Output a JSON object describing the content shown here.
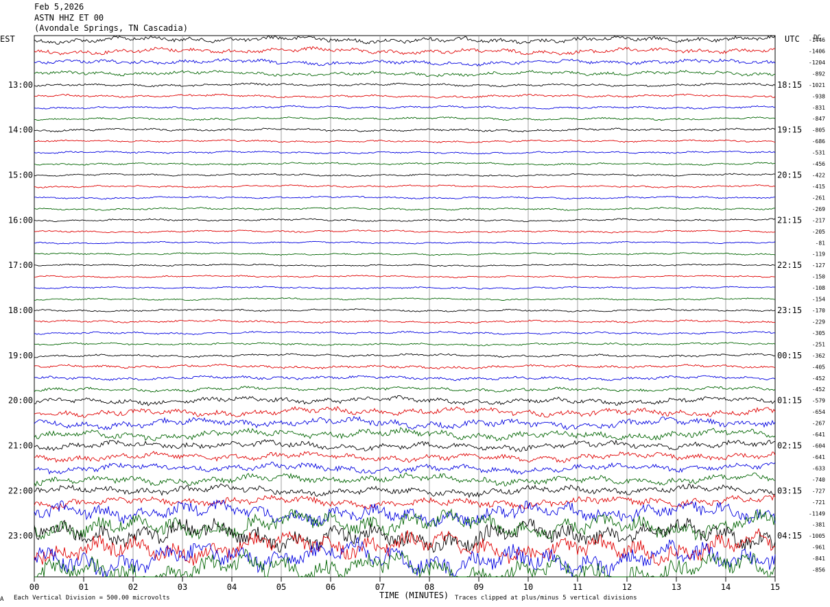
{
  "header": {
    "date": "Feb 5,2026",
    "station": "ASTN HHZ ET 00",
    "location": "(Avondale Springs, TN Cascadia)"
  },
  "left_axis_label": "EST",
  "right_axis_label": "UTC",
  "dc_label": "DC",
  "footer": {
    "scale_note": "Each Vertical Division = 500.00 microvolts",
    "xlabel": "TIME (MINUTES)",
    "clip_note": "Traces clipped at plus/minus 5 vertical divisions",
    "corner_mark": "A"
  },
  "trace_colors": [
    "#000000",
    "#e00000",
    "#0000e0",
    "#006400"
  ],
  "chart_data": {
    "type": "line",
    "title": "ASTN HHZ ET 00",
    "xlabel": "TIME (MINUTES)",
    "x_ticks": [
      "00",
      "01",
      "02",
      "03",
      "04",
      "05",
      "06",
      "07",
      "08",
      "09",
      "10",
      "11",
      "12",
      "13",
      "14",
      "15"
    ],
    "xlim": [
      0,
      15
    ],
    "hour_labels_left": [
      {
        "row": 4,
        "label": "13:00"
      },
      {
        "row": 8,
        "label": "14:00"
      },
      {
        "row": 12,
        "label": "15:00"
      },
      {
        "row": 16,
        "label": "16:00"
      },
      {
        "row": 20,
        "label": "17:00"
      },
      {
        "row": 24,
        "label": "18:00"
      },
      {
        "row": 28,
        "label": "19:00"
      },
      {
        "row": 32,
        "label": "20:00"
      },
      {
        "row": 36,
        "label": "21:00"
      },
      {
        "row": 40,
        "label": "22:00"
      },
      {
        "row": 44,
        "label": "23:00"
      }
    ],
    "hour_labels_right": [
      {
        "row": 4,
        "label": "18:15"
      },
      {
        "row": 8,
        "label": "19:15"
      },
      {
        "row": 12,
        "label": "20:15"
      },
      {
        "row": 16,
        "label": "21:15"
      },
      {
        "row": 20,
        "label": "22:15"
      },
      {
        "row": 24,
        "label": "23:15"
      },
      {
        "row": 28,
        "label": "00:15"
      },
      {
        "row": 32,
        "label": "01:15"
      },
      {
        "row": 36,
        "label": "02:15"
      },
      {
        "row": 40,
        "label": "03:15"
      },
      {
        "row": 44,
        "label": "04:15"
      }
    ],
    "dc_offsets": [
      "-1446",
      "-1406",
      "-1204",
      "-892",
      "-1021",
      "-938",
      "-831",
      "-847",
      "-805",
      "-686",
      "-531",
      "-456",
      "-422",
      "-415",
      "-261",
      "-269",
      "-217",
      "-205",
      "-81",
      "-119",
      "-127",
      "-150",
      "-108",
      "-154",
      "-170",
      "-229",
      "-305",
      "-251",
      "-362",
      "-405",
      "-452",
      "-452",
      "-579",
      "-654",
      "-267",
      "-641",
      "-604",
      "-641",
      "-633",
      "-740",
      "-727",
      "-721",
      "-1149",
      "-381",
      "-1005",
      "-961",
      "-841",
      "-856"
    ],
    "amplitude_levels": [
      2.2,
      2.0,
      1.8,
      1.6,
      1.0,
      1.0,
      0.9,
      0.9,
      1.0,
      0.8,
      0.8,
      0.8,
      0.8,
      0.8,
      0.8,
      0.8,
      0.8,
      0.8,
      0.7,
      0.7,
      0.7,
      0.7,
      0.7,
      0.7,
      0.8,
      0.9,
      0.9,
      0.9,
      1.0,
      1.2,
      1.3,
      1.5,
      2.4,
      2.8,
      3.2,
      3.2,
      2.8,
      2.8,
      3.0,
      3.2,
      3.2,
      3.5,
      7,
      8,
      9,
      9,
      10,
      10
    ],
    "num_traces": 48,
    "series": [
      {
        "name": "",
        "color": "#000000"
      },
      {
        "name": "",
        "color": "#e00000"
      },
      {
        "name": "",
        "color": "#0000e0"
      },
      {
        "name": "",
        "color": "#006400"
      }
    ]
  }
}
